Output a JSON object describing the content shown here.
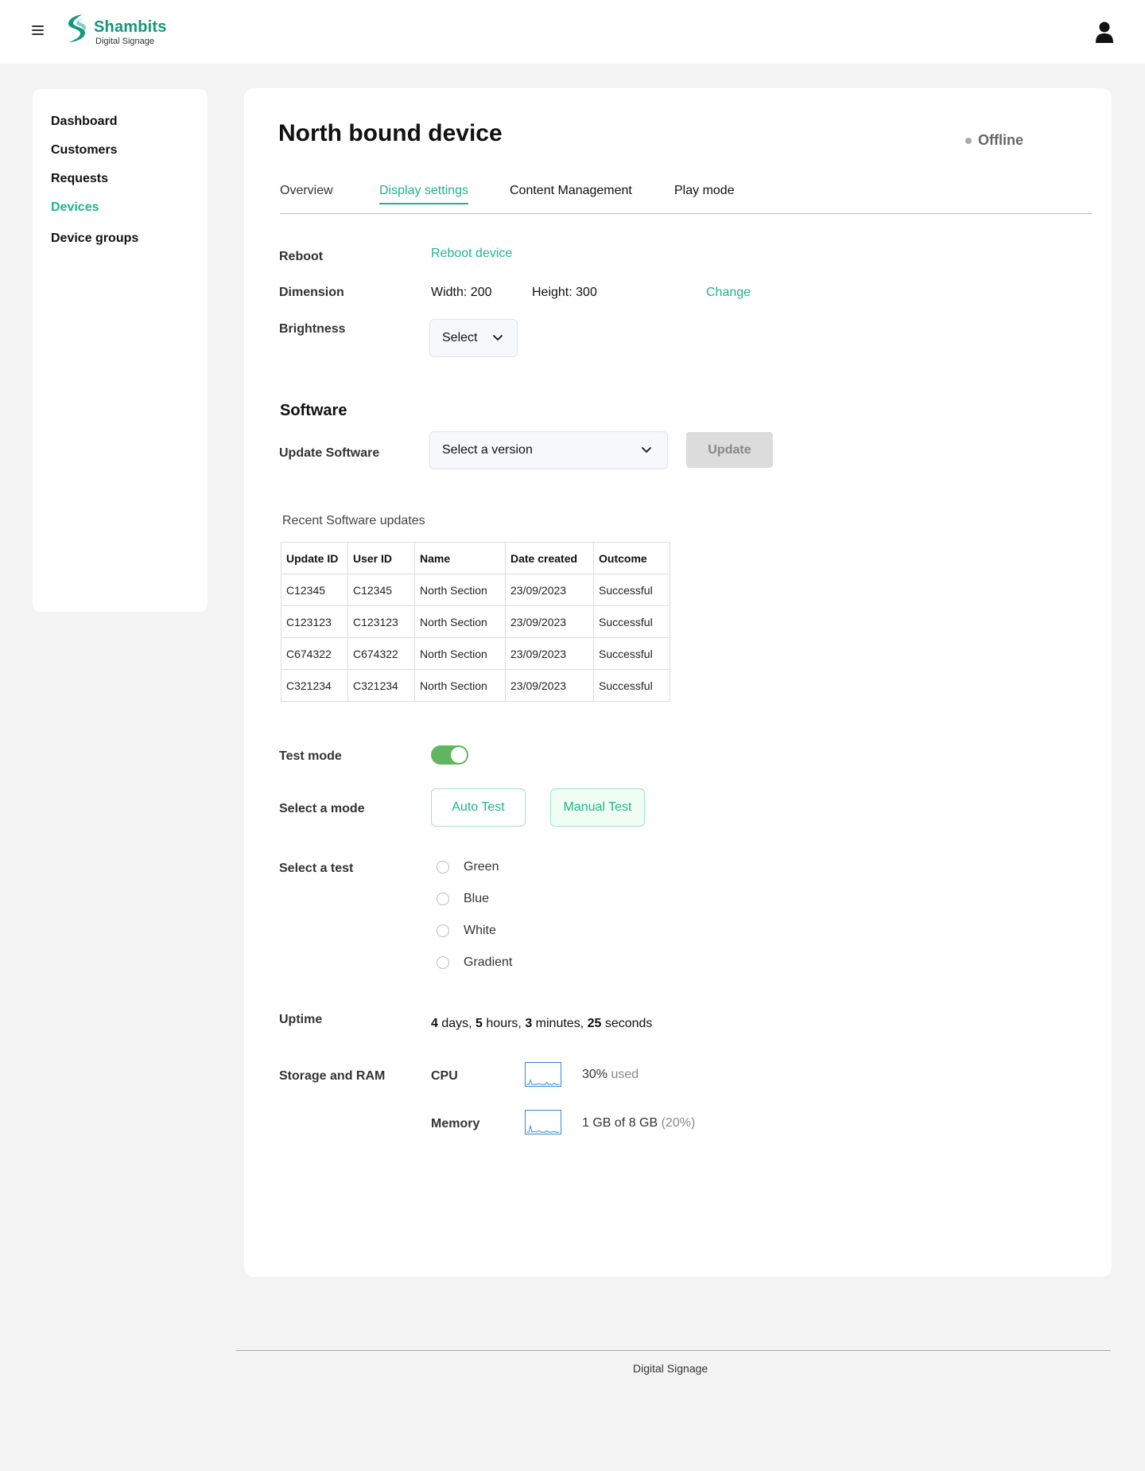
{
  "header": {
    "brand_name": "Shambits",
    "brand_subtitle": "Digital Signage",
    "brand_color": "#14977b"
  },
  "sidebar": {
    "items": [
      {
        "label": "Dashboard"
      },
      {
        "label": "Customers"
      },
      {
        "label": "Requests"
      },
      {
        "label": "Devices"
      },
      {
        "label": "Device groups"
      }
    ],
    "active": "Devices"
  },
  "page": {
    "title": "North bound device",
    "status": "Offline"
  },
  "tabs": [
    {
      "label": "Overview"
    },
    {
      "label": "Display settings"
    },
    {
      "label": "Content Management"
    },
    {
      "label": "Play mode"
    }
  ],
  "display": {
    "reboot_label": "Reboot",
    "reboot_link": "Reboot device",
    "dimension_label": "Dimension",
    "width_text": "Width: 200",
    "height_text": "Height: 300",
    "change_link": "Change",
    "brightness_label": "Brightness",
    "brightness_select": "Select"
  },
  "software": {
    "section_title": "Software",
    "update_label": "Update Software",
    "version_select": "Select a version",
    "update_button": "Update",
    "table_caption": "Recent Software updates",
    "columns": [
      "Update ID",
      "User ID",
      "Name",
      "Date created",
      "Outcome"
    ],
    "rows": [
      [
        "C12345",
        "C12345",
        "North Section",
        "23/09/2023",
        "Successful"
      ],
      [
        "C123123",
        "C123123",
        "North Section",
        "23/09/2023",
        "Successful"
      ],
      [
        "C674322",
        "C674322",
        "North Section",
        "23/09/2023",
        "Successful"
      ],
      [
        "C321234",
        "C321234",
        "North Section",
        "23/09/2023",
        "Successful"
      ]
    ]
  },
  "test": {
    "test_mode_label": "Test mode",
    "test_mode_on": true,
    "select_mode_label": "Select a mode",
    "modes": [
      "Auto Test",
      "Manual Test"
    ],
    "selected_mode": "Manual Test",
    "select_test_label": "Select a test",
    "tests": [
      "Green",
      "Blue",
      "White",
      "Gradient"
    ]
  },
  "uptime": {
    "label": "Uptime",
    "days": "4",
    "days_unit": " days, ",
    "hours": "5",
    "hours_unit": " hours, ",
    "minutes": "3",
    "minutes_unit": " minutes, ",
    "seconds": "25",
    "seconds_unit": " seconds"
  },
  "resources": {
    "label": "Storage and RAM",
    "cpu_label": "CPU",
    "cpu_value": "30%",
    "cpu_suffix": " used",
    "memory_label": "Memory",
    "memory_value": "1 GB of 8 GB",
    "memory_suffix": " (20%)"
  },
  "footer": {
    "text": "Digital Signage"
  }
}
